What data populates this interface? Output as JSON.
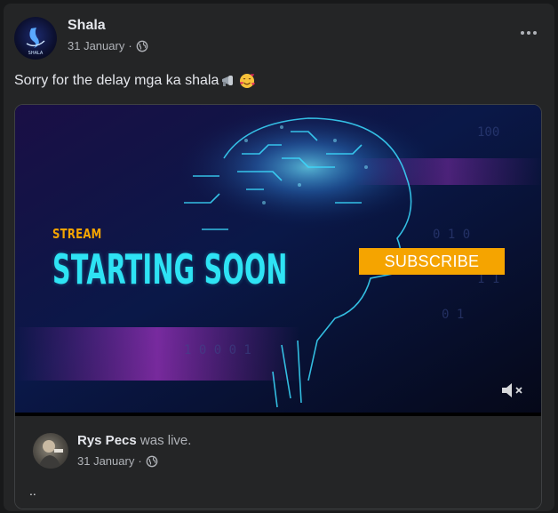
{
  "post": {
    "page_name": "Shala",
    "date": "31 January",
    "separator": "·",
    "audience_icon": "globe-icon",
    "more_icon": "more-options-icon",
    "caption": "Sorry for the delay mga ka shala",
    "caption_emojis": [
      "megaphone-emoji",
      "smiling-face-with-hearts-emoji"
    ],
    "avatar_logo_text": "SHALA"
  },
  "video": {
    "stream_label": "STREAM",
    "headline": "STARTING SOON",
    "subscribe_label": "SUBSCRIBE",
    "mute_icon": "speaker-muted-icon",
    "colors": {
      "headline": "#2ee3f4",
      "stream": "#f5a400",
      "subscribe_bg": "#f5a400"
    }
  },
  "attachment": {
    "user_name": "Rys Pecs",
    "status": "was live.",
    "date": "31 January",
    "separator": "·",
    "audience_icon": "globe-icon",
    "body": ".."
  }
}
